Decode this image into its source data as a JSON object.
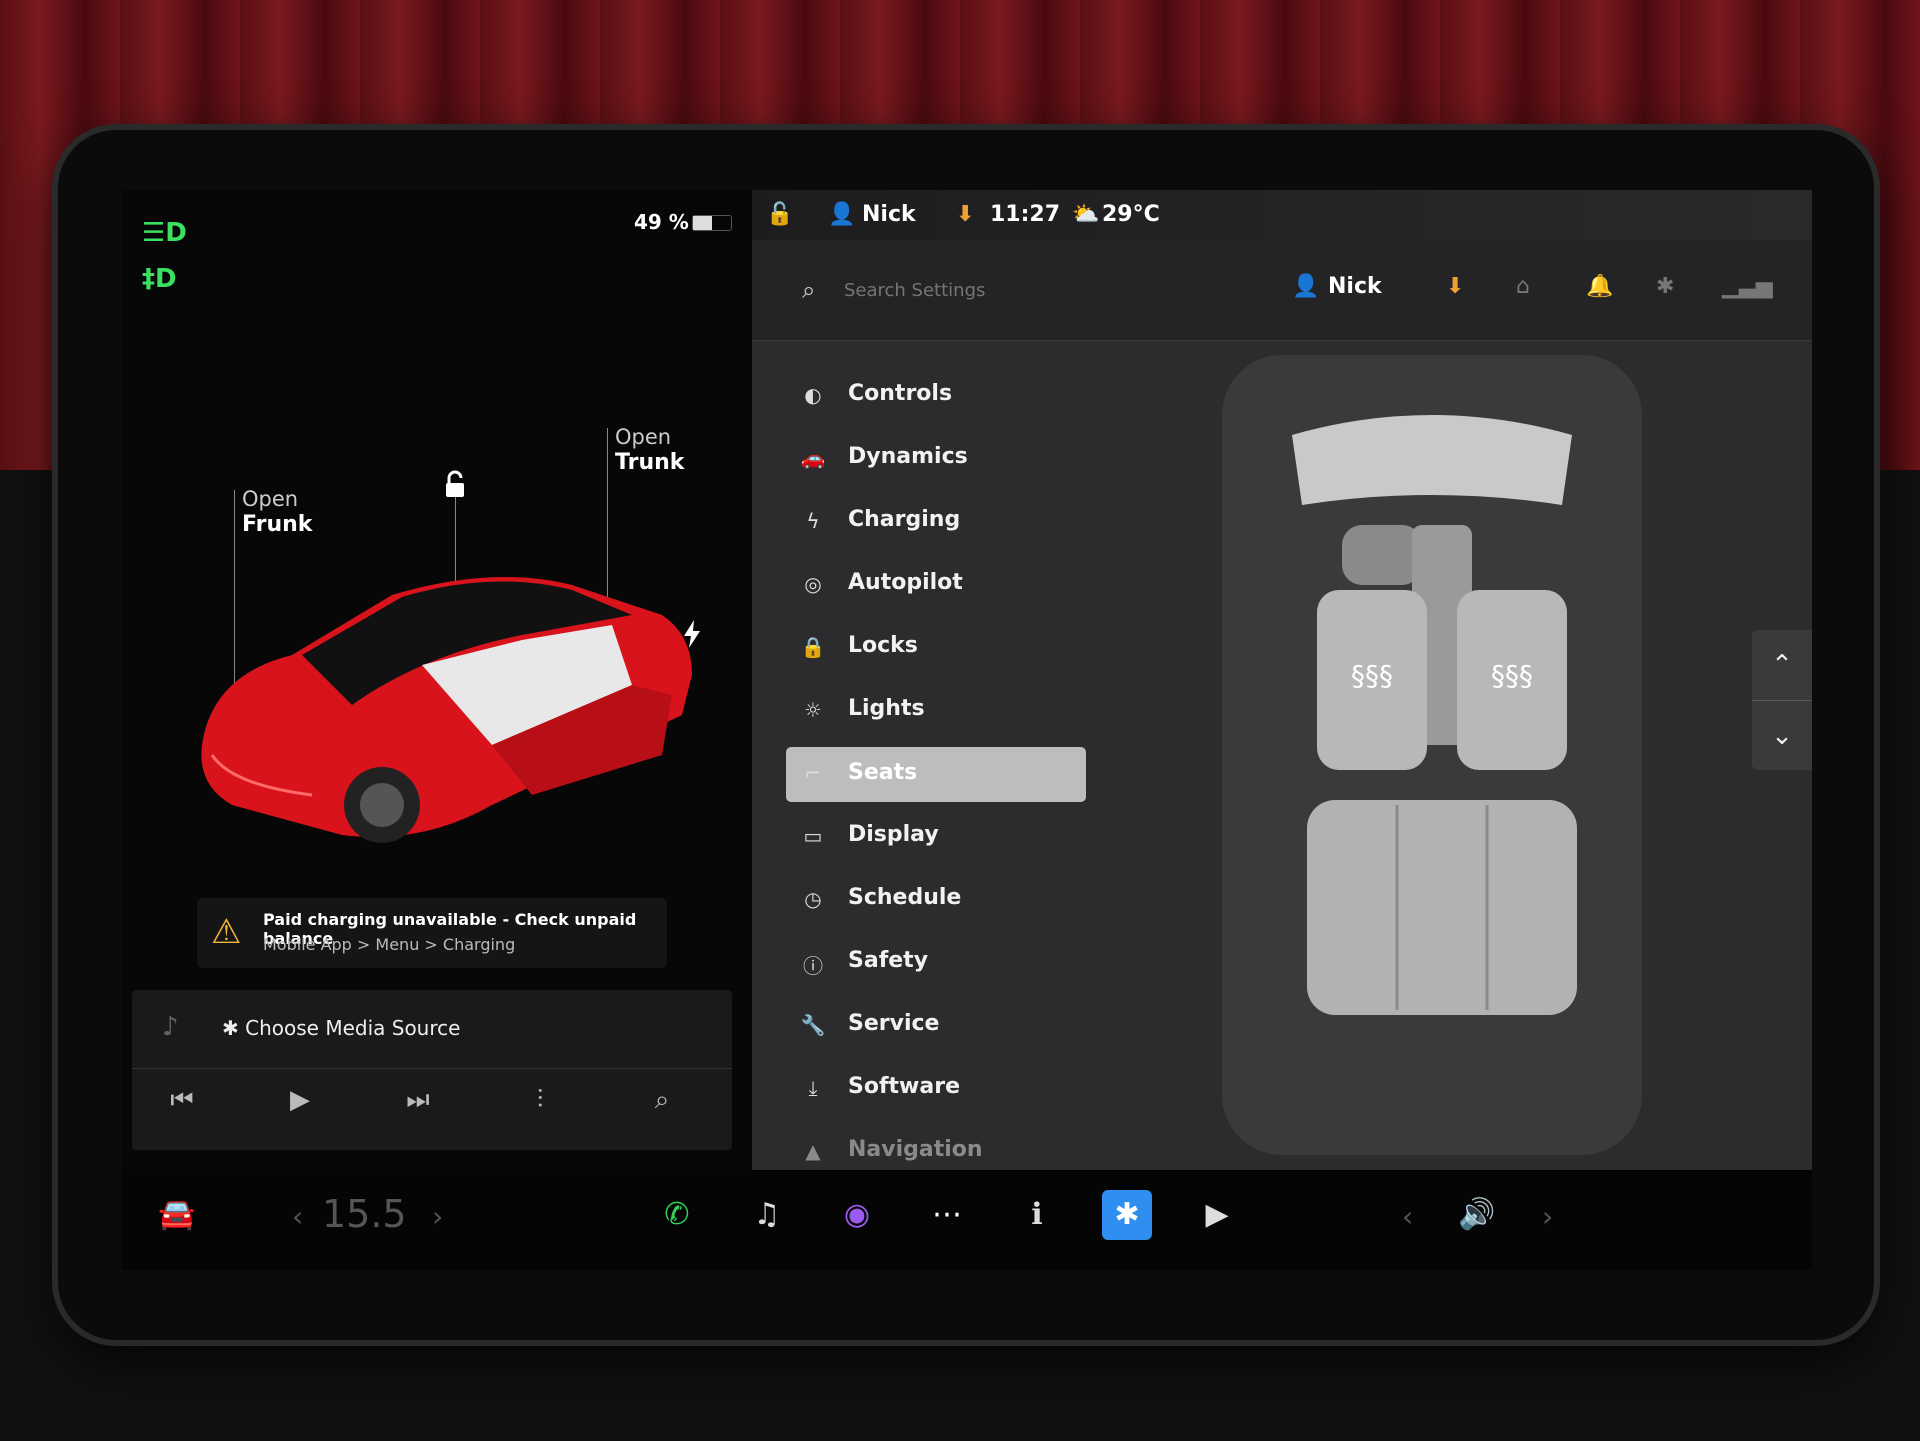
{
  "left": {
    "battery_percent": "49 %",
    "battery_level": 0.49,
    "lamp_icons": [
      "headlight-icon",
      "fog-light-icon"
    ],
    "frunk": {
      "top": "Open",
      "bottom": "Frunk"
    },
    "trunk": {
      "top": "Open",
      "bottom": "Trunk"
    },
    "alert": {
      "title": "Paid charging unavailable - Check unpaid balance",
      "path": "Mobile App > Menu > Charging"
    },
    "media": {
      "source_label": "Choose Media Source",
      "controls": [
        "previous-icon",
        "play-icon",
        "next-icon",
        "equalizer-icon",
        "search-icon"
      ]
    }
  },
  "status_bar": {
    "user": "Nick",
    "time": "11:27",
    "temperature": "29°C"
  },
  "settings": {
    "search_placeholder": "Search Settings",
    "user": "Nick",
    "menu": [
      {
        "label": "Controls",
        "icon": "toggle-icon"
      },
      {
        "label": "Dynamics",
        "icon": "car-icon"
      },
      {
        "label": "Charging",
        "icon": "bolt-icon"
      },
      {
        "label": "Autopilot",
        "icon": "steering-wheel-icon"
      },
      {
        "label": "Locks",
        "icon": "lock-icon"
      },
      {
        "label": "Lights",
        "icon": "sun-icon"
      },
      {
        "label": "Seats",
        "icon": "seat-icon",
        "selected": true
      },
      {
        "label": "Display",
        "icon": "display-icon"
      },
      {
        "label": "Schedule",
        "icon": "clock-icon"
      },
      {
        "label": "Safety",
        "icon": "info-icon"
      },
      {
        "label": "Service",
        "icon": "wrench-icon"
      },
      {
        "label": "Software",
        "icon": "download-icon"
      },
      {
        "label": "Navigation",
        "icon": "navigation-icon"
      }
    ]
  },
  "dock": {
    "temperature": "15.5",
    "apps": [
      "phone-icon",
      "music-icon",
      "camera-icon",
      "more-icon",
      "manual-icon",
      "bluetooth-icon",
      "theater-icon"
    ]
  },
  "colors": {
    "accent_orange": "#f0a030",
    "lamp_green": "#3be060",
    "car_red": "#d8131c"
  }
}
